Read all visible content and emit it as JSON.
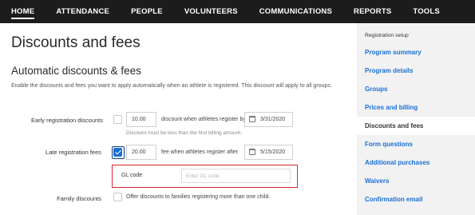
{
  "navbar": {
    "items": [
      {
        "label": "HOME",
        "active": true
      },
      {
        "label": "ATTENDANCE",
        "active": false
      },
      {
        "label": "PEOPLE",
        "active": false
      },
      {
        "label": "VOLUNTEERS",
        "active": false
      },
      {
        "label": "COMMUNICATIONS",
        "active": false
      },
      {
        "label": "REPORTS",
        "active": false
      },
      {
        "label": "TOOLS",
        "active": false
      }
    ]
  },
  "main": {
    "title": "Discounts and fees",
    "section_title": "Automatic discounts & fees",
    "description": "Enable the discounts and fees you want to apply automatically when an athlete is registered. This discount will apply to all groups.",
    "early": {
      "label": "Early registration discounts",
      "checked": false,
      "amount": "10.00",
      "text": "discount when athletes register by",
      "date": "3/31/2020",
      "hint": "Discount must be less than the first billing amount."
    },
    "late": {
      "label": "Late registration fees",
      "checked": true,
      "amount": "20.00",
      "text": "fee when athletes register after",
      "date": "5/15/2020"
    },
    "gl": {
      "label": "GL code",
      "placeholder": "Enter GL code"
    },
    "family": {
      "label": "Family discounts",
      "checked": false,
      "text": "Offer discounts to families registering more than one child."
    }
  },
  "sidebar": {
    "header": "Registration setup",
    "items": [
      {
        "label": "Program summary",
        "active": false
      },
      {
        "label": "Program details",
        "active": false
      },
      {
        "label": "Groups",
        "active": false
      },
      {
        "label": "Prices and billing",
        "active": false
      },
      {
        "label": "Discounts and fees",
        "active": true
      },
      {
        "label": "Form questions",
        "active": false
      },
      {
        "label": "Additional purchases",
        "active": false
      },
      {
        "label": "Waivers",
        "active": false
      },
      {
        "label": "Confirmation email",
        "active": false
      }
    ]
  },
  "colors": {
    "navbar_bg": "#1c1c1c",
    "link_blue": "#1a6fd6",
    "highlight_red": "#d9272e",
    "sidebar_bg": "#f2f2f2"
  }
}
